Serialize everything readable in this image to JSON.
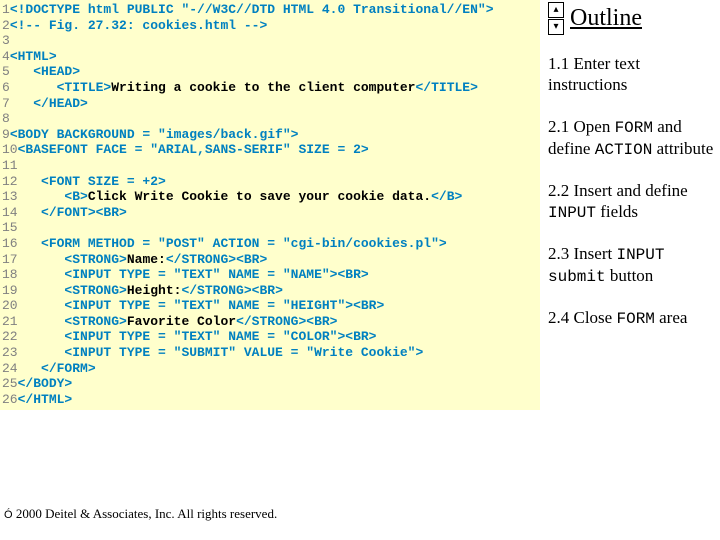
{
  "code": {
    "lines": [
      {
        "n": "1",
        "pad": "",
        "parts": [
          {
            "c": "tag",
            "t": "<!DOCTYPE html PUBLIC \"-//W3C//DTD HTML 4.0 Transitional//EN\">"
          }
        ]
      },
      {
        "n": "2",
        "pad": "",
        "parts": [
          {
            "c": "cmt",
            "t": "<!-- Fig. 27.32: cookies.html -->"
          }
        ]
      },
      {
        "n": "3",
        "pad": "",
        "parts": []
      },
      {
        "n": "4",
        "pad": "",
        "parts": [
          {
            "c": "tag",
            "t": "<HTML>"
          }
        ]
      },
      {
        "n": "5",
        "pad": "   ",
        "parts": [
          {
            "c": "tag",
            "t": "<HEAD>"
          }
        ]
      },
      {
        "n": "6",
        "pad": "      ",
        "parts": [
          {
            "c": "tag",
            "t": "<TITLE>"
          },
          {
            "c": "txt",
            "t": "Writing a cookie to the client computer"
          },
          {
            "c": "tag",
            "t": "</TITLE>"
          }
        ]
      },
      {
        "n": "7",
        "pad": "   ",
        "parts": [
          {
            "c": "tag",
            "t": "</HEAD>"
          }
        ]
      },
      {
        "n": "8",
        "pad": "",
        "parts": []
      },
      {
        "n": "9",
        "pad": "",
        "parts": [
          {
            "c": "tag",
            "t": "<BODY BACKGROUND = \"images/back.gif\">"
          }
        ]
      },
      {
        "n": "10",
        "pad": "",
        "parts": [
          {
            "c": "tag",
            "t": "<BASEFONT FACE = \"ARIAL,SANS-SERIF\" SIZE = 2>"
          }
        ]
      },
      {
        "n": "11",
        "pad": "",
        "parts": []
      },
      {
        "n": "12",
        "pad": "   ",
        "parts": [
          {
            "c": "tag",
            "t": "<FONT SIZE = +2>"
          }
        ]
      },
      {
        "n": "13",
        "pad": "      ",
        "parts": [
          {
            "c": "tag",
            "t": "<B>"
          },
          {
            "c": "txt",
            "t": "Click Write Cookie to save your cookie data."
          },
          {
            "c": "tag",
            "t": "</B>"
          }
        ]
      },
      {
        "n": "14",
        "pad": "   ",
        "parts": [
          {
            "c": "tag",
            "t": "</FONT><BR>"
          }
        ]
      },
      {
        "n": "15",
        "pad": "",
        "parts": []
      },
      {
        "n": "16",
        "pad": "   ",
        "parts": [
          {
            "c": "tag",
            "t": "<FORM METHOD = \"POST\" ACTION = \"cgi-bin/cookies.pl\">"
          }
        ]
      },
      {
        "n": "17",
        "pad": "      ",
        "parts": [
          {
            "c": "tag",
            "t": "<STRONG>"
          },
          {
            "c": "txt",
            "t": "Name:"
          },
          {
            "c": "tag",
            "t": "</STRONG><BR>"
          }
        ]
      },
      {
        "n": "18",
        "pad": "      ",
        "parts": [
          {
            "c": "tag",
            "t": "<INPUT TYPE = \"TEXT\" NAME = \"NAME\"><BR>"
          }
        ]
      },
      {
        "n": "19",
        "pad": "      ",
        "parts": [
          {
            "c": "tag",
            "t": "<STRONG>"
          },
          {
            "c": "txt",
            "t": "Height:"
          },
          {
            "c": "tag",
            "t": "</STRONG><BR>"
          }
        ]
      },
      {
        "n": "20",
        "pad": "      ",
        "parts": [
          {
            "c": "tag",
            "t": "<INPUT TYPE = \"TEXT\" NAME = \"HEIGHT\"><BR>"
          }
        ]
      },
      {
        "n": "21",
        "pad": "      ",
        "parts": [
          {
            "c": "tag",
            "t": "<STRONG>"
          },
          {
            "c": "txt",
            "t": "Favorite Color"
          },
          {
            "c": "tag",
            "t": "</STRONG><BR>"
          }
        ]
      },
      {
        "n": "22",
        "pad": "      ",
        "parts": [
          {
            "c": "tag",
            "t": "<INPUT TYPE = \"TEXT\" NAME = \"COLOR\"><BR>"
          }
        ]
      },
      {
        "n": "23",
        "pad": "      ",
        "parts": [
          {
            "c": "tag",
            "t": "<INPUT TYPE = \"SUBMIT\" VALUE = \"Write Cookie\">"
          }
        ]
      },
      {
        "n": "24",
        "pad": "   ",
        "parts": [
          {
            "c": "tag",
            "t": "</FORM>"
          }
        ]
      },
      {
        "n": "25",
        "pad": "",
        "parts": [
          {
            "c": "tag",
            "t": "</BODY>"
          }
        ]
      },
      {
        "n": "26",
        "pad": "",
        "parts": [
          {
            "c": "tag",
            "t": "</HTML>"
          }
        ]
      }
    ]
  },
  "outline": {
    "title": "Outline",
    "items": [
      [
        {
          "c": "",
          "t": "1.1 Enter text instructions"
        }
      ],
      [
        {
          "c": "",
          "t": "2.1 Open "
        },
        {
          "c": "kw",
          "t": "FORM"
        },
        {
          "c": "",
          "t": " and define "
        },
        {
          "c": "kw",
          "t": "ACTION"
        },
        {
          "c": "",
          "t": " attribute"
        }
      ],
      [
        {
          "c": "",
          "t": "2.2 Insert and define "
        },
        {
          "c": "kw",
          "t": "INPUT"
        },
        {
          "c": "",
          "t": " fields"
        }
      ],
      [
        {
          "c": "",
          "t": "2.3 Insert "
        },
        {
          "c": "kw",
          "t": "INPUT submit"
        },
        {
          "c": "",
          "t": " button"
        }
      ],
      [
        {
          "c": "",
          "t": "2.4 Close "
        },
        {
          "c": "kw",
          "t": "FORM"
        },
        {
          "c": "",
          "t": " area"
        }
      ]
    ]
  },
  "footer": {
    "copy_symbol": "Ó",
    "text": " 2000 Deitel & Associates, Inc.  All rights reserved."
  },
  "nav": {
    "up": "▴",
    "down": "▾"
  }
}
